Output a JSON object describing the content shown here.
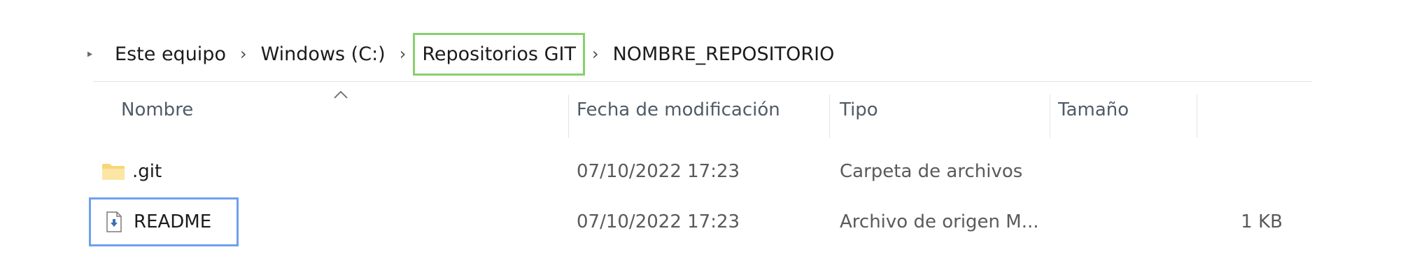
{
  "breadcrumb": {
    "items": [
      {
        "label": "Este equipo"
      },
      {
        "label": "Windows (C:)"
      },
      {
        "label": "Repositorios GIT"
      },
      {
        "label": "NOMBRE_REPOSITORIO"
      }
    ],
    "highlight_color": "#86d16b"
  },
  "columns": {
    "name": "Nombre",
    "date": "Fecha de modificación",
    "type": "Tipo",
    "size": "Tamaño"
  },
  "rows": [
    {
      "name": ".git",
      "icon": "folder-icon",
      "date": "07/10/2022 17:23",
      "type": "Carpeta de archivos",
      "size": ""
    },
    {
      "name": "README",
      "icon": "markdown-file-icon",
      "date": "07/10/2022 17:23",
      "type": "Archivo de origen M...",
      "size": "1 KB"
    }
  ],
  "selection_color": "#6fa0ee"
}
